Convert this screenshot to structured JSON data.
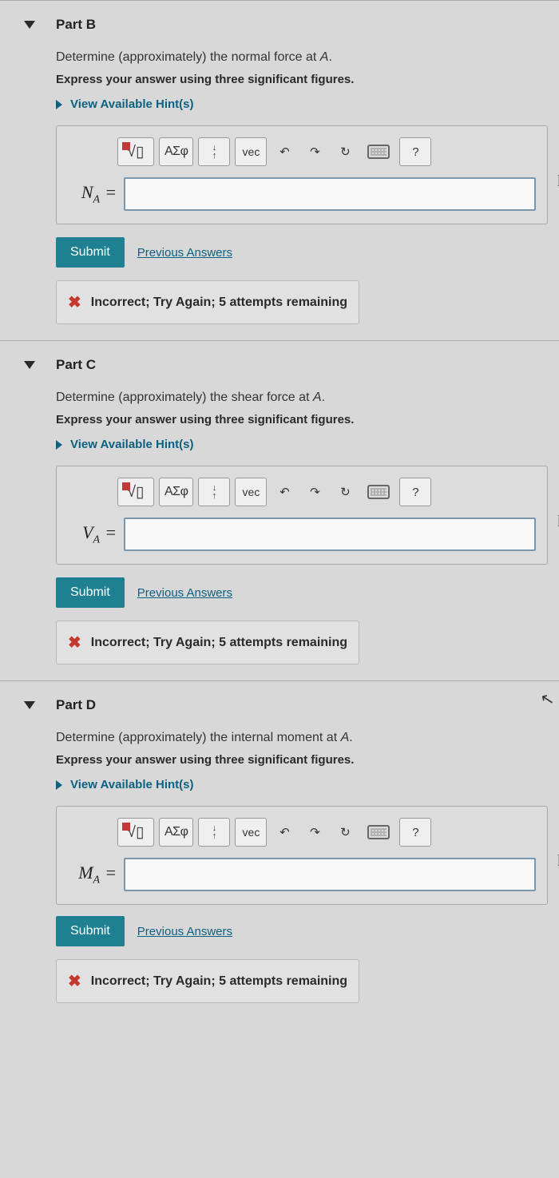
{
  "parts": [
    {
      "key": "B",
      "title": "Part B",
      "prompt_prefix": "Determine (approximately) the normal force at ",
      "prompt_var": "A",
      "prompt_suffix": ".",
      "instruction": "Express your answer using three significant figures.",
      "hints_label": "View Available Hint(s)",
      "variable_html": "N",
      "subscript": "A",
      "unit": "k",
      "submit": "Submit",
      "prev": "Previous Answers",
      "feedback": "Incorrect; Try Again; 5 attempts remaining"
    },
    {
      "key": "C",
      "title": "Part C",
      "prompt_prefix": "Determine (approximately) the shear force at ",
      "prompt_var": "A",
      "prompt_suffix": ".",
      "instruction": "Express your answer using three significant figures.",
      "hints_label": "View Available Hint(s)",
      "variable_html": "V",
      "subscript": "A",
      "unit": "k",
      "submit": "Submit",
      "prev": "Previous Answers",
      "feedback": "Incorrect; Try Again; 5 attempts remaining"
    },
    {
      "key": "D",
      "title": "Part D",
      "prompt_prefix": "Determine (approximately) the internal moment at ",
      "prompt_var": "A",
      "prompt_suffix": ".",
      "instruction": "Express your answer using three significant figures.",
      "hints_label": "View Available Hint(s)",
      "variable_html": "M",
      "subscript": "A",
      "unit": "k",
      "submit": "Submit",
      "prev": "Previous Answers",
      "feedback": "Incorrect; Try Again; 5 attempts remaining"
    }
  ],
  "toolbar": {
    "greek": "ΑΣφ",
    "vec": "vec",
    "help": "?"
  }
}
